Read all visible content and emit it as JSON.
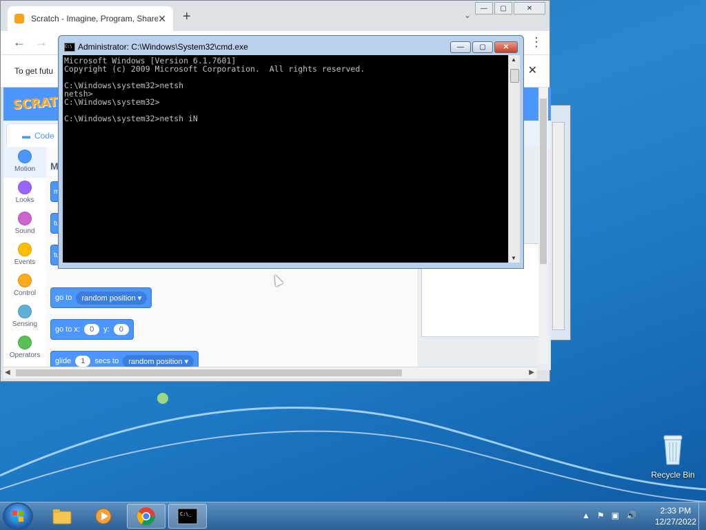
{
  "chrome": {
    "tab_title": "Scratch - Imagine, Program, Share",
    "infobar_text": "To get futu",
    "new_tab_glyph": "+"
  },
  "scratch": {
    "logo": "SCRATCH",
    "code_tab": "Code",
    "palette_heading": "M",
    "categories": [
      {
        "label": "Motion",
        "color": "#4c97ff"
      },
      {
        "label": "Looks",
        "color": "#9966ff"
      },
      {
        "label": "Sound",
        "color": "#cf63cf"
      },
      {
        "label": "Events",
        "color": "#ffbf00"
      },
      {
        "label": "Control",
        "color": "#ffab19"
      },
      {
        "label": "Sensing",
        "color": "#5cb1d6"
      },
      {
        "label": "Operators",
        "color": "#59c059"
      }
    ],
    "stub_blocks": [
      "m",
      "tu",
      "tu"
    ],
    "blocks": {
      "goto_label": "go to",
      "goto_option": "random position",
      "gotoxy_label": "go to x:",
      "gotoxy_x": "0",
      "gotoxy_y_label": "y:",
      "gotoxy_y": "0",
      "glide_label": "glide",
      "glide_secs": "1",
      "glide_secs_label": "secs to",
      "glide_option": "random position"
    }
  },
  "cmd": {
    "title": "Administrator: C:\\Windows\\System32\\cmd.exe",
    "lines": [
      "Microsoft Windows [Version 6.1.7601]",
      "Copyright (c) 2009 Microsoft Corporation.  All rights reserved.",
      "",
      "C:\\Windows\\system32>netsh",
      "netsh>",
      "C:\\Windows\\system32>",
      "",
      "C:\\Windows\\system32>netsh iN"
    ]
  },
  "desktop": {
    "recycle_bin": "Recycle Bin"
  },
  "taskbar": {
    "time": "2:33 PM",
    "date": "12/27/2022",
    "items": [
      "file-explorer",
      "media-player",
      "chrome",
      "cmd"
    ]
  }
}
